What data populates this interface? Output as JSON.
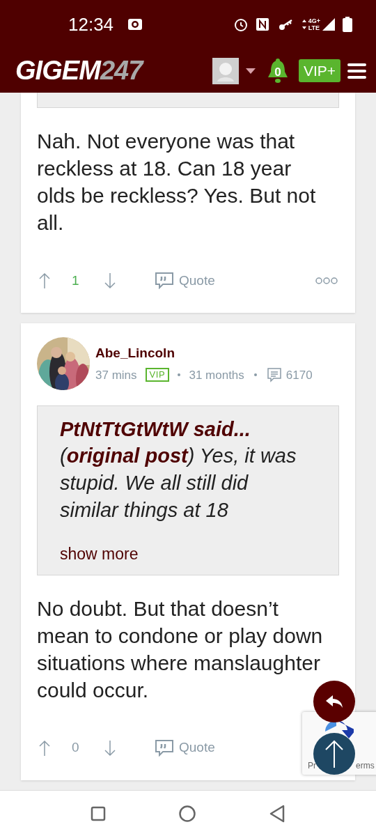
{
  "status_bar": {
    "time": "12:34",
    "network": "4G+",
    "network_type": "LTE"
  },
  "header": {
    "logo": "GIGEM",
    "logo_suffix": "247",
    "notifications": "0",
    "vip_button": "VIP+"
  },
  "posts": [
    {
      "partial": true,
      "body": "Nah. Not everyone was that reckless at 18. Can 18 year olds be reckless? Yes. But not all.",
      "score": "1",
      "color": "#4caf50",
      "quote_button": "Quote",
      "has_menu": true
    },
    {
      "partial": false,
      "author": "Abe_Lincoln",
      "time": "37 mins",
      "badge": "VIP",
      "tenure": "31 months",
      "post_count": "6170",
      "quote": {
        "author_line": "PtNtTtGtWtW said...",
        "text": "(**original post**) Yes, it was stupid. We all still did similar things at 18",
        "show_more": "show more"
      },
      "body": "No doubt. But that doesn’t mean to condone or play down situations where manslaughter could occur.",
      "score": "0",
      "color": "#8a9aa6",
      "quote_button": "Quote"
    }
  ],
  "recaptcha": {
    "text_left": "Pr",
    "text_right": "erms"
  }
}
